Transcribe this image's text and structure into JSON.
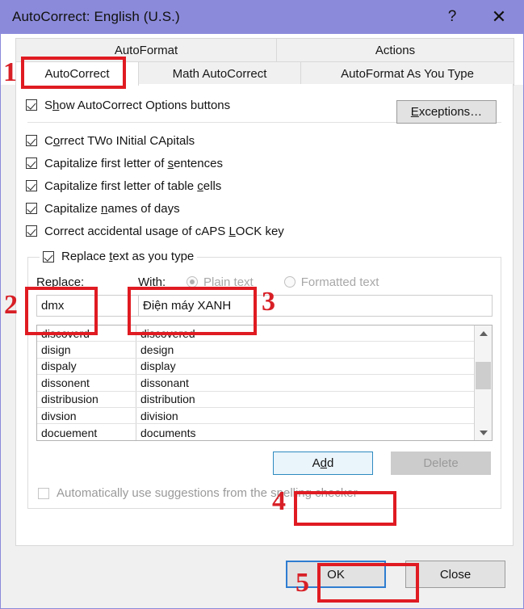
{
  "window": {
    "title": "AutoCorrect: English (U.S.)",
    "help_icon": "?",
    "close_icon": "✕",
    "titlebar_color": "#8b8ada"
  },
  "tabs": {
    "top_row": [
      {
        "label": "AutoFormat",
        "active": false
      },
      {
        "label": "Actions",
        "active": false
      }
    ],
    "bottom_row": [
      {
        "label": "AutoCorrect",
        "active": true
      },
      {
        "label": "Math AutoCorrect",
        "active": false
      },
      {
        "label": "AutoFormat As You Type",
        "active": false
      }
    ]
  },
  "options": {
    "show_buttons": {
      "label_pre": "S",
      "label_accel": "h",
      "label_post": "ow AutoCorrect Options buttons",
      "checked": true
    },
    "items": [
      {
        "pre": "C",
        "accel": "o",
        "post": "rrect TWo INitial CApitals",
        "checked": true
      },
      {
        "pre": "Capitalize first letter of ",
        "accel": "s",
        "post": "entences",
        "checked": true
      },
      {
        "pre": "Capitalize first letter of table ",
        "accel": "c",
        "post": "ells",
        "checked": true
      },
      {
        "pre": "Capitalize ",
        "accel": "n",
        "post": "ames of days",
        "checked": true
      },
      {
        "pre": "Correct accidental usage of cAPS ",
        "accel": "L",
        "post": "OCK key",
        "checked": true
      }
    ],
    "exceptions_button": {
      "pre": "",
      "accel": "E",
      "post": "xceptions…"
    }
  },
  "replace_group": {
    "legend": {
      "pre": "Replace ",
      "accel": "t",
      "post": "ext as you type",
      "checked": true
    },
    "replace_label": {
      "accel": "R",
      "post": "eplace:"
    },
    "with_label": {
      "accel": "W",
      "post": "ith:"
    },
    "plain_text_label": "Plain text",
    "formatted_text_label": "Formatted text",
    "plain_text_selected": true,
    "replace_value": "dmx",
    "with_value": "Điện máy XANH"
  },
  "list": {
    "rows": [
      {
        "from": "discoverd",
        "to": "discovered"
      },
      {
        "from": "disign",
        "to": "design"
      },
      {
        "from": "dispaly",
        "to": "display"
      },
      {
        "from": "dissonent",
        "to": "dissonant"
      },
      {
        "from": "distribusion",
        "to": "distribution"
      },
      {
        "from": "divsion",
        "to": "division"
      },
      {
        "from": "docuement",
        "to": "documents"
      }
    ],
    "scroll_up_icon": "scroll-up-arrow",
    "scroll_down_icon": "scroll-down-arrow"
  },
  "actions": {
    "add": {
      "pre": "A",
      "accel": "d",
      "post": "d"
    },
    "delete": {
      "label": "Delete",
      "enabled": false
    },
    "auto_suggest": {
      "label": "Automatically use suggestions from the spelling checker",
      "checked": false,
      "enabled": false
    }
  },
  "footer": {
    "ok": "OK",
    "close": "Close"
  },
  "annotations": {
    "accent_color": "#e01b22",
    "markers": [
      {
        "number": "1",
        "target": "autocorrect-tab"
      },
      {
        "number": "2",
        "target": "replace-field"
      },
      {
        "number": "3",
        "target": "with-field"
      },
      {
        "number": "4",
        "target": "add-button"
      },
      {
        "number": "5",
        "target": "ok-button"
      }
    ]
  }
}
